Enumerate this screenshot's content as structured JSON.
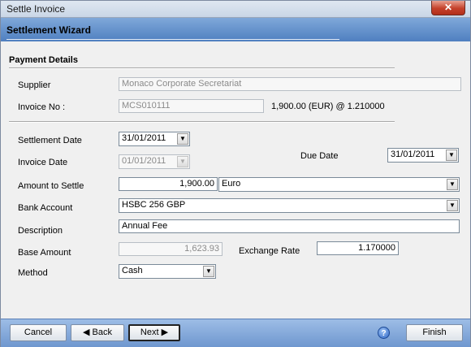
{
  "window": {
    "title": "Settle Invoice",
    "close_glyph": "✕"
  },
  "wizard": {
    "title": "Settlement Wizard"
  },
  "section": {
    "title": "Payment Details"
  },
  "labels": {
    "supplier": "Supplier",
    "invoice_no": "Invoice No :",
    "settlement_date": "Settlement Date",
    "invoice_date": "Invoice Date",
    "due_date": "Due Date",
    "amount_to_settle": "Amount to Settle",
    "bank_account": "Bank Account",
    "description": "Description",
    "base_amount": "Base Amount",
    "exchange_rate": "Exchange Rate",
    "method": "Method"
  },
  "values": {
    "supplier": "Monaco Corporate Secretariat",
    "invoice_no": "MCS010111",
    "invoice_amount_info": "1,900.00 (EUR) @ 1.210000",
    "settlement_date": "31/01/2011",
    "invoice_date": "01/01/2011",
    "due_date": "31/01/2011",
    "amount_to_settle": "1,900.00",
    "currency": "Euro",
    "bank_account": "HSBC 256 GBP",
    "description": "Annual Fee",
    "base_amount": "1,623.93",
    "exchange_rate": "1.170000",
    "method": "Cash"
  },
  "footer": {
    "cancel": "Cancel",
    "back": "◀  Back",
    "next": "Next  ▶",
    "finish": "Finish",
    "help_glyph": "?"
  },
  "icons": {
    "combo_arrow": "▼"
  }
}
